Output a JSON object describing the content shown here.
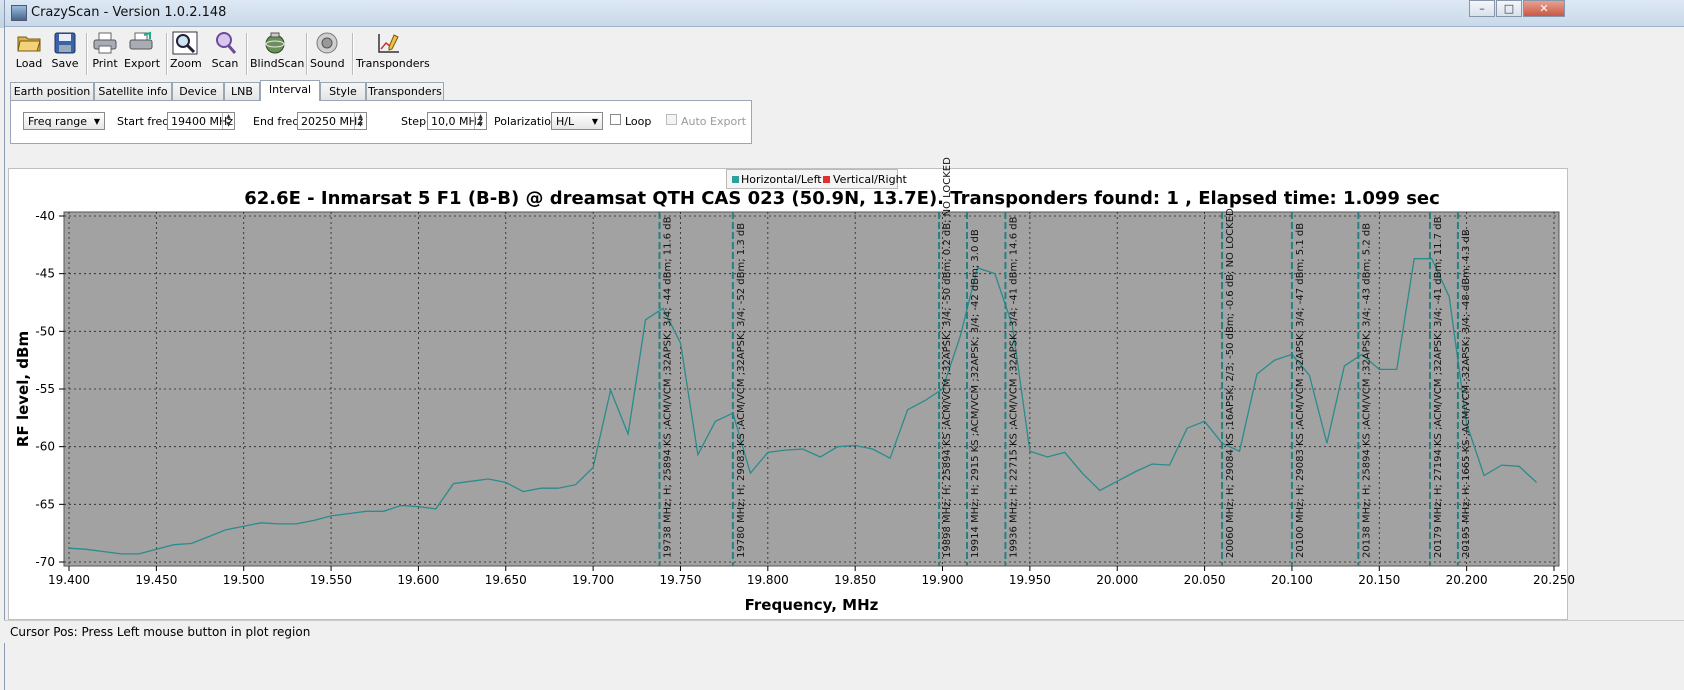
{
  "window": {
    "title": "CrazyScan - Version 1.0.2.148"
  },
  "toolbar": [
    {
      "label": "Load",
      "icon": "folder-open-icon"
    },
    {
      "label": "Save",
      "icon": "floppy-disk-icon"
    },
    {
      "label": "Print",
      "icon": "printer-icon"
    },
    {
      "label": "Export",
      "icon": "export-printer-icon"
    },
    {
      "label": "Zoom",
      "icon": "magnifier-icon"
    },
    {
      "label": "Scan",
      "icon": "scan-magnifier-icon"
    },
    {
      "label": "BlindScan",
      "icon": "satellite-globe-icon"
    },
    {
      "label": "Sound",
      "icon": "speaker-icon"
    },
    {
      "label": "Transponders",
      "icon": "chart-pencil-icon"
    }
  ],
  "tabs": [
    {
      "label": "Earth position"
    },
    {
      "label": "Satellite info"
    },
    {
      "label": "Device"
    },
    {
      "label": "LNB"
    },
    {
      "label": "Interval",
      "active": true
    },
    {
      "label": "Style"
    },
    {
      "label": "Transponders"
    }
  ],
  "interval": {
    "mode": "Freq range",
    "start_label": "Start freq",
    "start_value": "19400 MHz",
    "end_label": "End freq",
    "end_value": "20250 MHz",
    "step_label": "Step",
    "step_value": "10,0 MHz",
    "pol_label": "Polarization",
    "pol_value": "H/L",
    "loop_label": "Loop",
    "loop_checked": false,
    "autoexport_label": "Auto Export",
    "autoexport_enabled": false
  },
  "status": {
    "text": "Cursor Pos: Press Left mouse button in plot region"
  },
  "colors": {
    "plot_bg": "#a2a2a2",
    "trace": "#2a8c8c",
    "marker": "#2a8080",
    "legend_h": "#2e9e9e",
    "legend_v": "#e03030"
  },
  "chart_data": {
    "type": "line",
    "title": "62.6E - Inmarsat 5 F1 (B-B) @ dreamsat QTH CAS 023 (50.9N, 13.7E). Transponders found: 1 , Elapsed time: 1.099 sec",
    "xlabel": "Frequency, MHz",
    "ylabel": "RF level, dBm",
    "xlim": [
      19400,
      20250
    ],
    "ylim": [
      -70,
      -40
    ],
    "x_ticks": [
      19400,
      19450,
      19500,
      19550,
      19600,
      19650,
      19700,
      19750,
      19800,
      19850,
      19900,
      19950,
      20000,
      20050,
      20100,
      20150,
      20200,
      20250
    ],
    "x_tick_labels": [
      "19.400",
      "19.450",
      "19.500",
      "19.550",
      "19.600",
      "19.650",
      "19.700",
      "19.750",
      "19.800",
      "19.850",
      "19.900",
      "19.950",
      "20.000",
      "20.050",
      "20.100",
      "20.150",
      "20.200",
      "20.250"
    ],
    "y_ticks": [
      -70,
      -65,
      -60,
      -55,
      -50,
      -45,
      -40
    ],
    "y_tick_labels": [
      "-70",
      "-65",
      "-60",
      "-55",
      "-50",
      "-45",
      "-40"
    ],
    "grid": true,
    "legend": [
      "Horizontal/Left",
      "Vertical/Right"
    ],
    "legend_position": "top-center",
    "series": [
      {
        "name": "Horizontal/Left",
        "x": [
          19400,
          19410,
          19420,
          19430,
          19440,
          19450,
          19460,
          19470,
          19480,
          19490,
          19500,
          19510,
          19520,
          19530,
          19540,
          19550,
          19560,
          19570,
          19580,
          19590,
          19600,
          19610,
          19620,
          19630,
          19640,
          19650,
          19660,
          19670,
          19680,
          19690,
          19700,
          19710,
          19720,
          19730,
          19740,
          19750,
          19760,
          19770,
          19780,
          19790,
          19800,
          19810,
          19820,
          19830,
          19840,
          19850,
          19860,
          19870,
          19880,
          19890,
          19900,
          19910,
          19920,
          19930,
          19940,
          19950,
          19960,
          19970,
          19980,
          19990,
          20000,
          20010,
          20020,
          20030,
          20040,
          20050,
          20060,
          20070,
          20080,
          20090,
          20100,
          20110,
          20120,
          20130,
          20140,
          20150,
          20160,
          20170,
          20180,
          20190,
          20200,
          20210,
          20220,
          20230,
          20240
        ],
        "y": [
          -68.8,
          -68.9,
          -69.1,
          -69.3,
          -69.3,
          -68.9,
          -68.5,
          -68.4,
          -67.8,
          -67.2,
          -66.9,
          -66.6,
          -66.7,
          -66.7,
          -66.4,
          -66.0,
          -65.8,
          -65.6,
          -65.6,
          -65.1,
          -65.2,
          -65.4,
          -63.2,
          -63.0,
          -62.8,
          -63.1,
          -63.9,
          -63.6,
          -63.6,
          -63.3,
          -61.8,
          -55.1,
          -58.9,
          -49.0,
          -48.0,
          -51.0,
          -60.7,
          -57.8,
          -57.1,
          -62.3,
          -60.5,
          -60.3,
          -60.2,
          -60.9,
          -60.0,
          -59.9,
          -60.2,
          -61.0,
          -56.8,
          -56.0,
          -55.0,
          -50.5,
          -44.5,
          -45.0,
          -49.5,
          -60.4,
          -60.9,
          -60.5,
          -62.3,
          -63.8,
          -63.0,
          -62.2,
          -61.5,
          -61.6,
          -58.4,
          -57.8,
          -59.7,
          -60.4,
          -53.7,
          -52.5,
          -52.0,
          -53.8,
          -59.7,
          -53.0,
          -52.0,
          -53.3,
          -53.3,
          -43.7,
          -43.7,
          -47.0,
          -58.0,
          -62.5,
          -61.6,
          -61.7,
          -63.1
        ]
      },
      {
        "name": "Vertical/Right",
        "x": [],
        "y": []
      }
    ],
    "annotations": [
      {
        "x": 19738,
        "text": "19738 MHz; H; 25894 KS ;ACM/VCM ;32APSK; 3/4; -44 dBm; 11.6 dB"
      },
      {
        "x": 19780,
        "text": "19780 MHz; H; 29083 KS ;ACM/VCM ;32APSK; 3/4; -52 dBm; 1.3 dB"
      },
      {
        "x": 19898,
        "text": "19898 MHz; H; 25894 KS ;ACM/VCM ;32APSK; 3/4; -50 dBm; 0.2 dB; NO LOCKED"
      },
      {
        "x": 19914,
        "text": "19914 MHz; H; 2915 KS ;ACM/VCM ;32APSK; 3/4; -42 dBm; 3.0 dB"
      },
      {
        "x": 19936,
        "text": "19936 MHz; H; 22715 KS ;ACM/VCM ;32APSK; 3/4; -41 dBm; 14.6 dB"
      },
      {
        "x": 20060,
        "text": "20060 MHz; H; 29084 KS ;16APSK; 2/3; -50 dBm; -0.6 dB; NO LOCKED"
      },
      {
        "x": 20100,
        "text": "20100 MHz; H; 29083 KS ;ACM/VCM ;32APSK; 3/4; -47 dBm; 5.1 dB"
      },
      {
        "x": 20138,
        "text": "20138 MHz; H; 25894 KS ;ACM/VCM ;32APSK; 3/4; -43 dBm; 5.2 dB"
      },
      {
        "x": 20179,
        "text": "20179 MHz; H; 27194 KS ;ACM/VCM ;32APSK; 3/4; -41 dBm; 11.7 dB"
      },
      {
        "x": 20195,
        "text": "20195 MHz; H; 1665 KS ;ACM/VCM ;32APSK; 3/4; -48 dBm; 4.3 dB"
      }
    ]
  }
}
